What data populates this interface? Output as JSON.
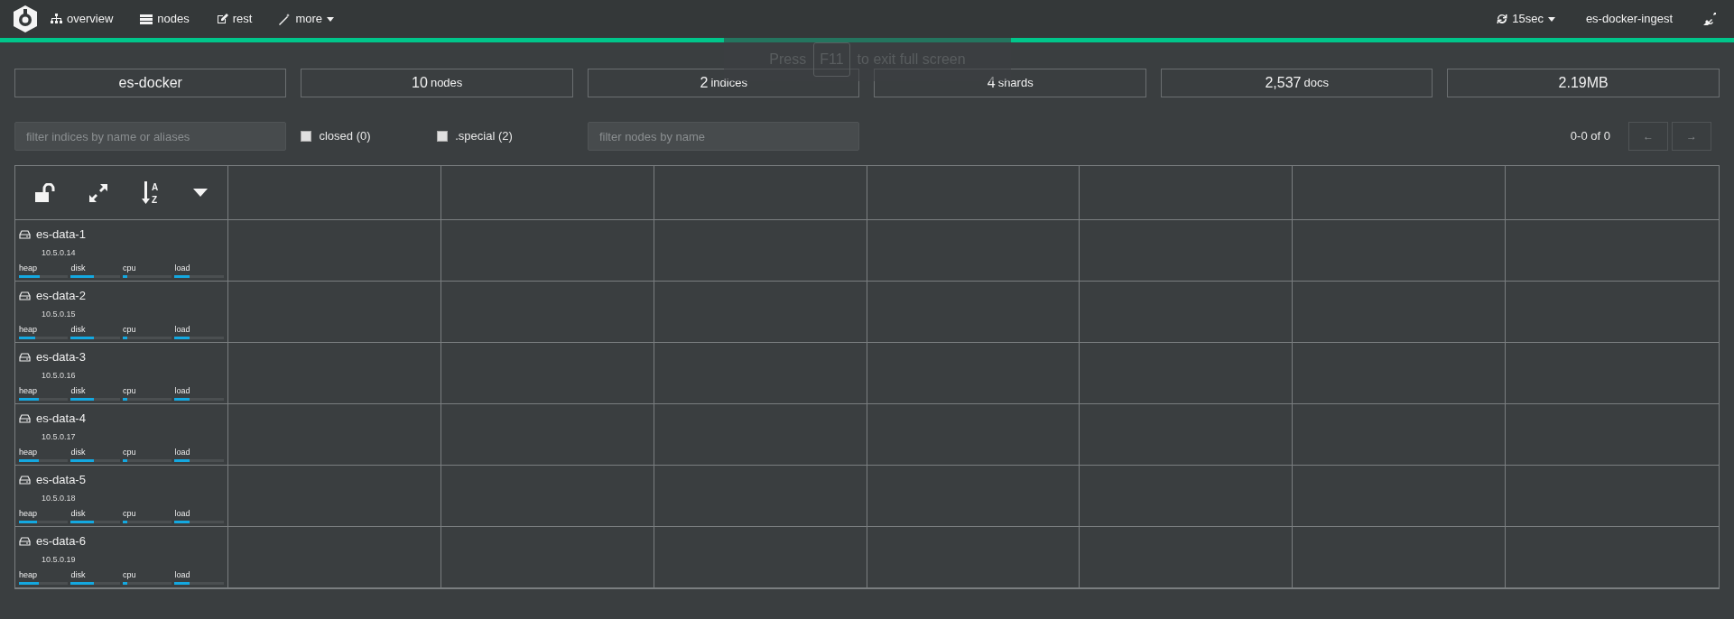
{
  "navbar": {
    "items": [
      {
        "label": "overview",
        "kind": "sitemap"
      },
      {
        "label": "nodes",
        "kind": "list"
      },
      {
        "label": "rest",
        "kind": "edit"
      },
      {
        "label": "more",
        "kind": "wand",
        "dropdown": true
      }
    ],
    "refresh": "15sec",
    "cluster": "es-docker-ingest"
  },
  "fullscreen_notice": {
    "before": "Press",
    "key": "F11",
    "after": "to exit full screen"
  },
  "stats": [
    {
      "value": "es-docker"
    },
    {
      "value": "10",
      "unit": "nodes"
    },
    {
      "value": "2",
      "unit": "indices"
    },
    {
      "value": "4",
      "unit": "shards"
    },
    {
      "value": "2,537",
      "unit": "docs"
    },
    {
      "value": "2.19MB"
    }
  ],
  "filters": {
    "indices": {
      "placeholder": "filter indices by name or aliases"
    },
    "closed": {
      "label": "closed (0)",
      "checked": false
    },
    "special": {
      "label": ".special (2)",
      "checked": false
    },
    "nodes": {
      "placeholder": "filter nodes by name"
    }
  },
  "sort_icon": {
    "top": "A",
    "bottom": "Z"
  },
  "pagination": {
    "range": "0-0 of 0",
    "prev": "←",
    "next": "→"
  },
  "nodes": [
    {
      "name": "es-data-1",
      "ip": "10.5.0.14",
      "metrics": [
        {
          "label": "heap",
          "level": 0.42
        },
        {
          "label": "disk",
          "level": 0.46
        },
        {
          "label": "cpu",
          "level": 0.1
        },
        {
          "label": "load",
          "level": 0.3
        }
      ]
    },
    {
      "name": "es-data-2",
      "ip": "10.5.0.15",
      "metrics": [
        {
          "label": "heap",
          "level": 0.33
        },
        {
          "label": "disk",
          "level": 0.46
        },
        {
          "label": "cpu",
          "level": 0.1
        },
        {
          "label": "load",
          "level": 0.3
        }
      ]
    },
    {
      "name": "es-data-3",
      "ip": "10.5.0.16",
      "metrics": [
        {
          "label": "heap",
          "level": 0.4
        },
        {
          "label": "disk",
          "level": 0.46
        },
        {
          "label": "cpu",
          "level": 0.1
        },
        {
          "label": "load",
          "level": 0.3
        }
      ]
    },
    {
      "name": "es-data-4",
      "ip": "10.5.0.17",
      "metrics": [
        {
          "label": "heap",
          "level": 0.4
        },
        {
          "label": "disk",
          "level": 0.46
        },
        {
          "label": "cpu",
          "level": 0.1
        },
        {
          "label": "load",
          "level": 0.3
        }
      ]
    },
    {
      "name": "es-data-5",
      "ip": "10.5.0.18",
      "metrics": [
        {
          "label": "heap",
          "level": 0.36
        },
        {
          "label": "disk",
          "level": 0.46
        },
        {
          "label": "cpu",
          "level": 0.1
        },
        {
          "label": "load",
          "level": 0.3
        }
      ]
    },
    {
      "name": "es-data-6",
      "ip": "10.5.0.19",
      "metrics": [
        {
          "label": "heap",
          "level": 0.4
        },
        {
          "label": "disk",
          "level": 0.46
        },
        {
          "label": "cpu",
          "level": 0.1
        },
        {
          "label": "load",
          "level": 0.3
        }
      ]
    }
  ]
}
